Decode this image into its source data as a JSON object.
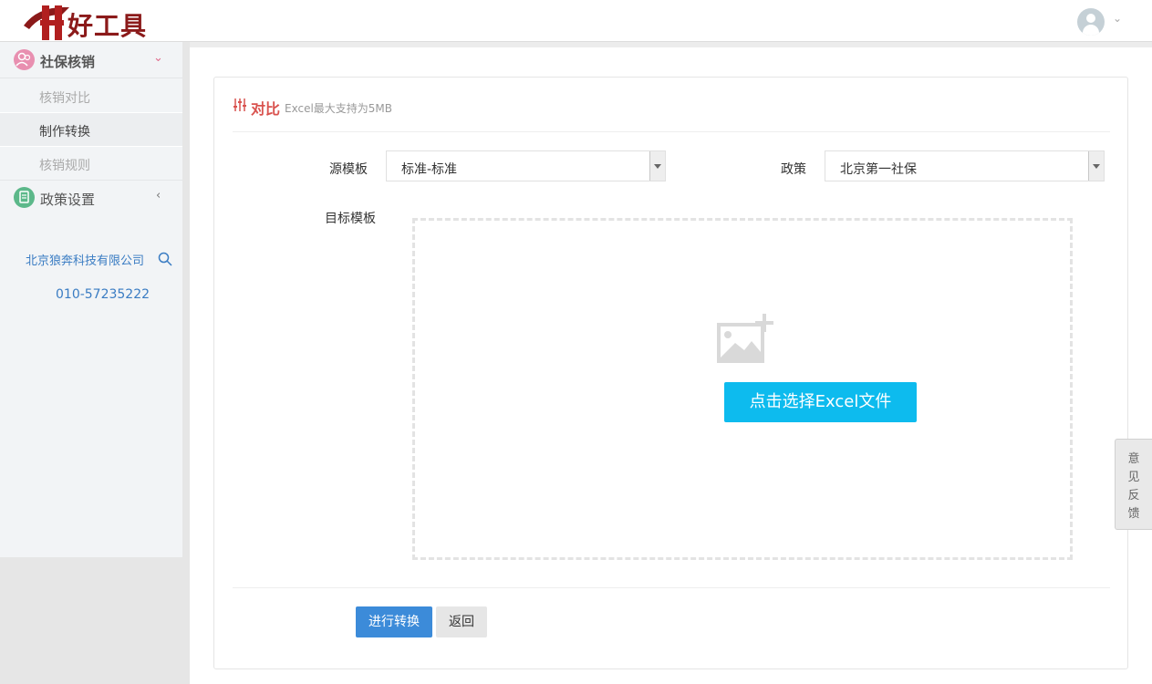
{
  "header": {
    "logo_text": "好工具",
    "logo_icon": "logo-icon",
    "avatar_icon": "user-avatar-icon",
    "caret_icon": "chevron-down-icon"
  },
  "sidebar": {
    "groups": [
      {
        "title": "社保核销",
        "icon": "people-icon",
        "icon_color": "#e88fb0",
        "caret": "chevron-down-icon",
        "items": [
          {
            "label": "核销对比",
            "state": "normal"
          },
          {
            "label": "制作转换",
            "state": "active"
          },
          {
            "label": "核销规则",
            "state": "normal"
          }
        ]
      },
      {
        "title": "政策设置",
        "icon": "document-icon",
        "icon_color": "#5cb88a",
        "caret": "chevron-left-icon"
      }
    ],
    "company": "北京狼奔科技有限公司",
    "phone": "010-57235222"
  },
  "card": {
    "title": "对比",
    "subtitle": "Excel最大支持为5MB",
    "title_icon": "sliders-icon",
    "source_label": "源模板",
    "source_value": "标准-标准",
    "policy_label": "政策",
    "policy_value": "北京第一社保",
    "target_label": "目标模板",
    "upload_icon": "image-add-icon",
    "upload_button": "点击选择Excel文件",
    "convert_button": "进行转换",
    "back_button": "返回"
  },
  "feedback": {
    "chars": [
      "意",
      "见",
      "反",
      "馈"
    ]
  },
  "colors": {
    "brand_red": "#8b1a1a",
    "accent_blue": "#0dbbee",
    "primary_btn": "#3c8bd9",
    "title_red": "#d9534f",
    "link_blue": "#3a7cc3"
  }
}
